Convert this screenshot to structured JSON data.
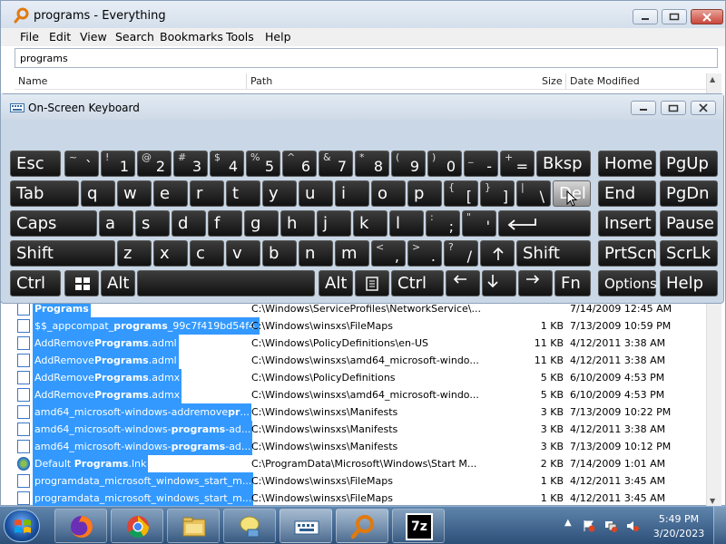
{
  "everything": {
    "title": "programs - Everything",
    "menu": [
      "File",
      "Edit",
      "View",
      "Search",
      "Bookmarks",
      "Tools",
      "Help"
    ],
    "search_value": "programs",
    "columns": [
      "Name",
      "Path",
      "Size",
      "Date Modified"
    ],
    "rows": [
      {
        "pre": "",
        "bold": "Programs",
        "post": "",
        "path": "C:\\Windows\\ServiceProfiles\\NetworkService\\...",
        "size": "",
        "date": "7/14/2009 12:45 AM",
        "icon": "folder"
      },
      {
        "pre": "$$_appcompat_",
        "bold": "programs",
        "post": "_99c7f419bd54f4...",
        "path": "C:\\Windows\\winsxs\\FileMaps",
        "size": "1 KB",
        "date": "7/13/2009 10:59 PM",
        "icon": "file"
      },
      {
        "pre": "AddRemove",
        "bold": "Programs",
        "post": ".adml",
        "path": "C:\\Windows\\PolicyDefinitions\\en-US",
        "size": "11 KB",
        "date": "4/12/2011 3:38 AM",
        "icon": "file"
      },
      {
        "pre": "AddRemove",
        "bold": "Programs",
        "post": ".adml",
        "path": "C:\\Windows\\winsxs\\amd64_microsoft-windo...",
        "size": "11 KB",
        "date": "4/12/2011 3:38 AM",
        "icon": "file"
      },
      {
        "pre": "AddRemove",
        "bold": "Programs",
        "post": ".admx",
        "path": "C:\\Windows\\PolicyDefinitions",
        "size": "5 KB",
        "date": "6/10/2009 4:53 PM",
        "icon": "file"
      },
      {
        "pre": "AddRemove",
        "bold": "Programs",
        "post": ".admx",
        "path": "C:\\Windows\\winsxs\\amd64_microsoft-windo...",
        "size": "5 KB",
        "date": "6/10/2009 4:53 PM",
        "icon": "file"
      },
      {
        "pre": "amd64_microsoft-windows-addremove",
        "bold": "pr",
        "post": "...",
        "path": "C:\\Windows\\winsxs\\Manifests",
        "size": "3 KB",
        "date": "7/13/2009 10:22 PM",
        "icon": "file"
      },
      {
        "pre": "amd64_microsoft-windows-",
        "bold": "programs",
        "post": "-ad...",
        "path": "C:\\Windows\\winsxs\\Manifests",
        "size": "3 KB",
        "date": "4/12/2011 3:38 AM",
        "icon": "file"
      },
      {
        "pre": "amd64_microsoft-windows-",
        "bold": "programs",
        "post": "-ad...",
        "path": "C:\\Windows\\winsxs\\Manifests",
        "size": "3 KB",
        "date": "7/13/2009 10:12 PM",
        "icon": "file"
      },
      {
        "pre": "Default ",
        "bold": "Programs",
        "post": ".lnk",
        "path": "C:\\ProgramData\\Microsoft\\Windows\\Start M...",
        "size": "2 KB",
        "date": "7/14/2009 1:01 AM",
        "icon": "lnk"
      },
      {
        "pre": "programdata_microsoft_windows_start_m...",
        "bold": "",
        "post": "",
        "path": "C:\\Windows\\winsxs\\FileMaps",
        "size": "1 KB",
        "date": "4/12/2011 3:45 AM",
        "icon": "file"
      },
      {
        "pre": "programdata_microsoft_windows_start_m...",
        "bold": "",
        "post": "",
        "path": "C:\\Windows\\winsxs\\FileMaps",
        "size": "1 KB",
        "date": "4/12/2011 3:45 AM",
        "icon": "file"
      }
    ]
  },
  "osk": {
    "title": "On-Screen Keyboard",
    "keys": {
      "esc": "Esc",
      "tilde_main": "`",
      "tilde_alt": "~",
      "n1": "1",
      "n1_alt": "!",
      "n2": "2",
      "n2_alt": "@",
      "n3": "3",
      "n3_alt": "#",
      "n4": "4",
      "n4_alt": "$",
      "n5": "5",
      "n5_alt": "%",
      "n6": "6",
      "n6_alt": "^",
      "n7": "7",
      "n7_alt": "&",
      "n8": "8",
      "n8_alt": "*",
      "n9": "9",
      "n9_alt": "(",
      "n0": "0",
      "n0_alt": ")",
      "minus": "-",
      "minus_alt": "_",
      "equals": "=",
      "equals_alt": "+",
      "bksp": "Bksp",
      "home": "Home",
      "pgup": "PgUp",
      "tab": "Tab",
      "q": "q",
      "w": "w",
      "e": "e",
      "r": "r",
      "t": "t",
      "y": "y",
      "u": "u",
      "i": "i",
      "o": "o",
      "p": "p",
      "lbracket": "[",
      "lbracket_alt": "{",
      "rbracket": "]",
      "rbracket_alt": "}",
      "backslash": "\\",
      "backslash_alt": "|",
      "del": "Del",
      "end": "End",
      "pgdn": "PgDn",
      "caps": "Caps",
      "a": "a",
      "s": "s",
      "d": "d",
      "f": "f",
      "g": "g",
      "h": "h",
      "j": "j",
      "k": "k",
      "l": "l",
      "semicolon": ";",
      "semicolon_alt": ":",
      "quote": "'",
      "quote_alt": "\"",
      "insert": "Insert",
      "pause": "Pause",
      "shift": "Shift",
      "z": "z",
      "x": "x",
      "c": "c",
      "v": "v",
      "b": "b",
      "n": "n",
      "m": "m",
      "comma": ",",
      "comma_alt": "<",
      "period": ".",
      "period_alt": ">",
      "slash": "/",
      "slash_alt": "?",
      "shift_r": "Shift",
      "prtscn": "PrtScn",
      "scrlk": "ScrLk",
      "ctrl": "Ctrl",
      "alt": "Alt",
      "alt_r": "Alt",
      "ctrl_r": "Ctrl",
      "fn": "Fn",
      "options": "Options",
      "help": "Help"
    }
  },
  "taskbar": {
    "time": "5:49 PM",
    "date": "3/20/2023",
    "apps": [
      "firefox-icon",
      "chrome-icon",
      "explorer-icon",
      "network-icon",
      "keyboard-icon",
      "everything-icon",
      "7zip-icon"
    ],
    "seven_zip_label": "7z"
  },
  "colors": {
    "selection": "#3399ff",
    "key_dark": "#1a1a1a",
    "taskbar": "#3c628c"
  }
}
